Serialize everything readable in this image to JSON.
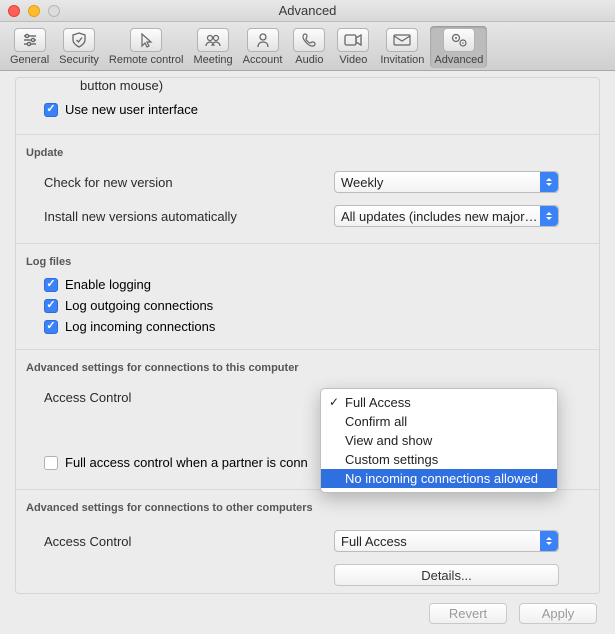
{
  "window": {
    "title": "Advanced"
  },
  "toolbar": [
    {
      "label": "General"
    },
    {
      "label": "Security"
    },
    {
      "label": "Remote control"
    },
    {
      "label": "Meeting"
    },
    {
      "label": "Account"
    },
    {
      "label": "Audio"
    },
    {
      "label": "Video"
    },
    {
      "label": "Invitation"
    },
    {
      "label": "Advanced"
    }
  ],
  "partial": {
    "line": "button mouse)",
    "checkbox_label": "Use new user interface"
  },
  "update": {
    "heading": "Update",
    "check_label": "Check for new version",
    "check_value": "Weekly",
    "install_label": "Install new versions automatically",
    "install_value": "All updates (includes new major…"
  },
  "logs": {
    "heading": "Log files",
    "enable": "Enable logging",
    "outgoing": "Log outgoing connections",
    "incoming": "Log incoming connections"
  },
  "adv_this": {
    "heading": "Advanced settings for connections to this computer",
    "access_label": "Access Control",
    "full_access_partner": "Full access control when a partner is conn",
    "menu": {
      "items": [
        "Full Access",
        "Confirm all",
        "View and show",
        "Custom settings",
        "No incoming connections allowed"
      ],
      "checked_index": 0,
      "highlighted_index": 4
    }
  },
  "adv_other": {
    "heading": "Advanced settings for connections to other computers",
    "access_label": "Access Control",
    "access_value": "Full Access",
    "details": "Details..."
  },
  "footer": {
    "revert": "Revert",
    "apply": "Apply"
  }
}
